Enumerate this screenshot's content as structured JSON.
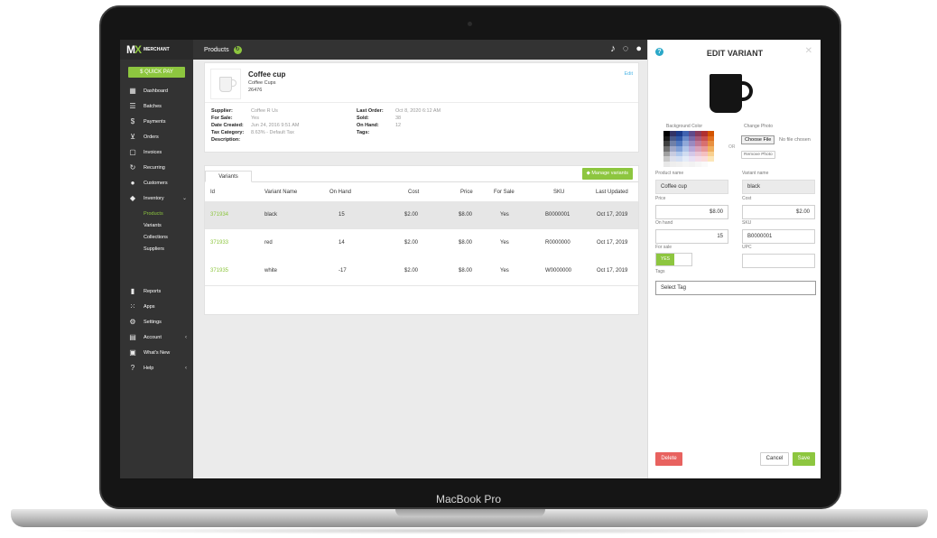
{
  "device": {
    "label": "MacBook Pro"
  },
  "sidebar": {
    "brand_name": "MERCHANT",
    "quick_pay": "$ QUICK PAY",
    "items": [
      {
        "label": "Dashboard",
        "icon": "dashboard-icon"
      },
      {
        "label": "Batches",
        "icon": "list-icon"
      },
      {
        "label": "Payments",
        "icon": "dollar-icon"
      },
      {
        "label": "Orders",
        "icon": "cart-icon"
      },
      {
        "label": "Invoices",
        "icon": "clipboard-icon"
      },
      {
        "label": "Recurring",
        "icon": "refresh-icon"
      },
      {
        "label": "Customers",
        "icon": "users-icon"
      },
      {
        "label": "Inventory",
        "icon": "tag-icon"
      }
    ],
    "inventory_sub": [
      "Products",
      "Variants",
      "Collections",
      "Suppliers"
    ],
    "bottom_items": [
      {
        "label": "Reports",
        "icon": "bar-chart-icon"
      },
      {
        "label": "Apps",
        "icon": "grid-icon"
      },
      {
        "label": "Settings",
        "icon": "gear-icon"
      },
      {
        "label": "Account",
        "icon": "store-icon"
      },
      {
        "label": "What's New",
        "icon": "calendar-icon"
      },
      {
        "label": "Help",
        "icon": "help-icon"
      }
    ]
  },
  "topbar": {
    "title": "Products"
  },
  "product": {
    "name": "Coffee cup",
    "category": "Coffee Cups",
    "id": "26476",
    "edit_label": "Edit",
    "left_labels": [
      "Supplier:",
      "For Sale:",
      "Date Created:",
      "Tax Category:",
      "Description:"
    ],
    "left_values": [
      "Coffee R Us",
      "Yes",
      "Jun 24, 2016 9:51 AM",
      "8.63% - Default Tax",
      ""
    ],
    "right_labels": [
      "Last Order:",
      "Sold:",
      "On Hand:",
      "Tags:"
    ],
    "right_values": [
      "Oct 8, 2020 6:12 AM",
      "38",
      "12",
      ""
    ]
  },
  "variants_table": {
    "tab_label": "Variants",
    "manage_label": "Manage variants",
    "columns": [
      "Id",
      "Variant Name",
      "On Hand",
      "Cost",
      "Price",
      "For Sale",
      "SKU",
      "Last Updated"
    ],
    "rows": [
      [
        "371934",
        "black",
        "15",
        "$2.00",
        "$8.00",
        "Yes",
        "B0000001",
        "Oct 17, 2019"
      ],
      [
        "371933",
        "red",
        "14",
        "$2.00",
        "$8.00",
        "Yes",
        "R0000000",
        "Oct 17, 2019"
      ],
      [
        "371935",
        "white",
        "-17",
        "$2.00",
        "$8.00",
        "Yes",
        "W0000000",
        "Oct 17, 2019"
      ]
    ]
  },
  "edit_panel": {
    "title": "EDIT VARIANT",
    "background_color_label": "Background Color",
    "change_photo_label": "Change Photo",
    "or_label": "OR",
    "choose_file": "Choose File",
    "no_file": "No file chosen",
    "remove_photo": "Remove Photo",
    "product_name_label": "Product name",
    "product_name": "Coffee cup",
    "variant_name_label": "Variant name",
    "variant_name": "black",
    "price_label": "Price",
    "price": "$8.00",
    "cost_label": "Cost",
    "cost": "$2.00",
    "on_hand_label": "On hand",
    "on_hand": "15",
    "sku_label": "SKU",
    "sku": "B0000001",
    "for_sale_label": "For sale",
    "for_sale_value": "YES",
    "upc_label": "UPC",
    "upc": "",
    "tags_label": "Tags",
    "tags_placeholder": "Select Tag",
    "delete_label": "Delete",
    "cancel_label": "Cancel",
    "save_label": "Save"
  },
  "colors": {
    "accent": "#8dc63f",
    "sidebar": "#333333",
    "danger": "#e8625f",
    "link": "#4cb5e6"
  }
}
